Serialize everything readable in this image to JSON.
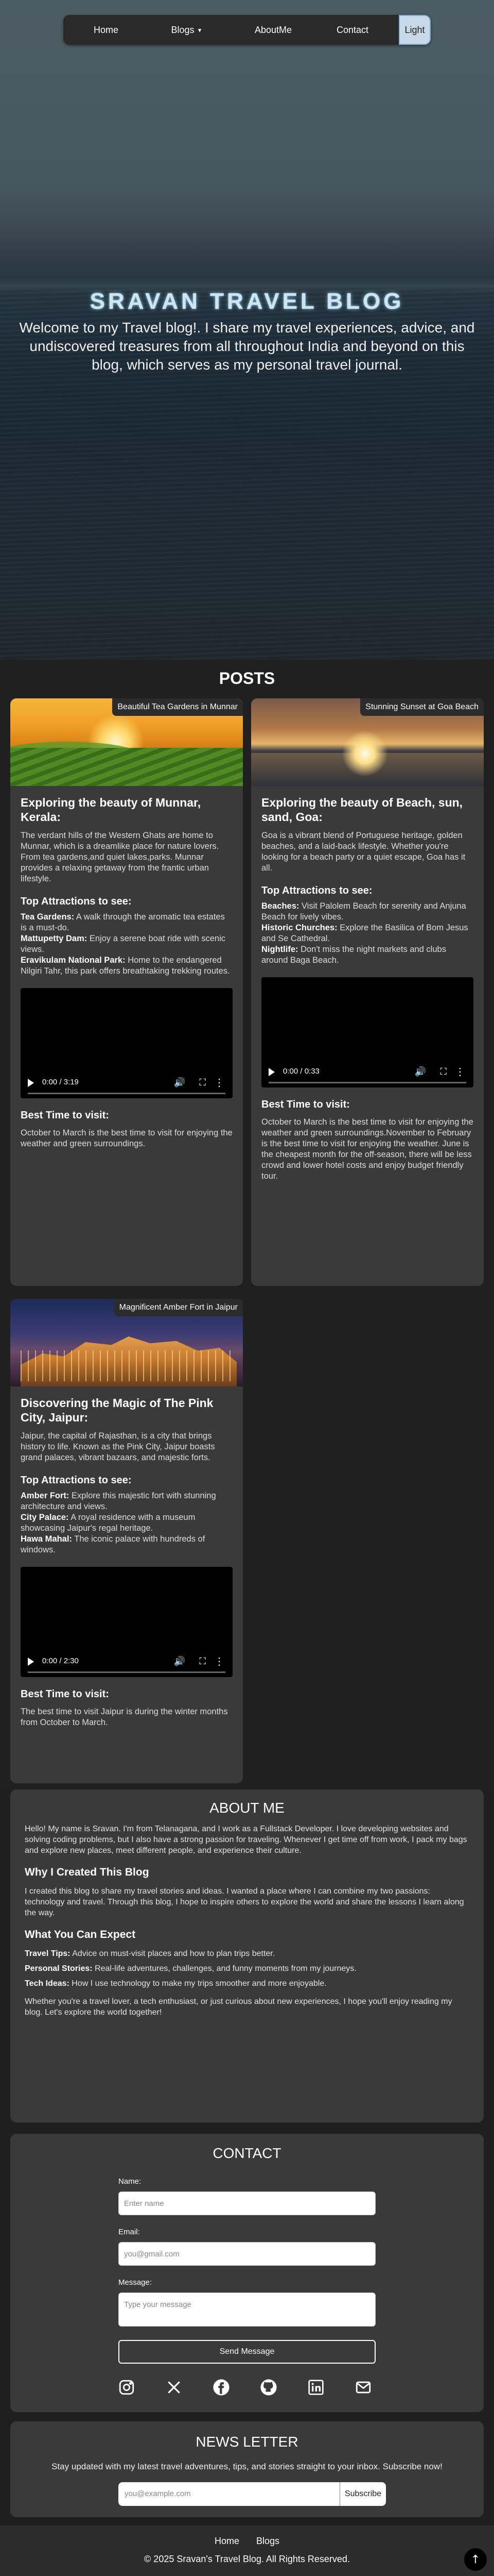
{
  "nav": {
    "home": "Home",
    "blogs": "Blogs",
    "about": "AboutMe",
    "contact": "Contact",
    "theme_toggle": "Light"
  },
  "hero": {
    "title": "SRAVAN TRAVEL BLOG",
    "subtitle": "Welcome to my Travel blog!. I share my travel experiences, advice, and undiscovered treasures from all throughout India and beyond on this blog, which serves as my personal travel journal."
  },
  "posts": {
    "title": "POSTS",
    "items": [
      {
        "caption": "Beautiful Tea Gardens in Munnar",
        "heading": "Exploring the beauty of Munnar, Kerala:",
        "intro": "The verdant hills of the Western Ghats are home to Munnar, which is a dreamlike place for nature lovers. From tea gardens,and quiet lakes,parks. Munnar provides a relaxing getaway from the frantic urban lifestyle.",
        "attractions_title": "Top Attractions to see:",
        "attractions": [
          {
            "name": "Tea Gardens:",
            "desc": "A walk through the aromatic tea estates is a must-do."
          },
          {
            "name": "Mattupetty Dam:",
            "desc": "Enjoy a serene boat ride with scenic views."
          },
          {
            "name": "Eravikulam National Park:",
            "desc": "Home to the endangered Nilgiri Tahr, this park offers breathtaking trekking routes."
          }
        ],
        "video_time": "0:00 / 3:19",
        "best_title": "Best Time to visit:",
        "best_text": "October to March is the best time to visit for enjoying the weather and green surroundings."
      },
      {
        "caption": "Stunning Sunset at Goa Beach",
        "heading": "Exploring the beauty of Beach, sun, sand, Goa:",
        "intro": "Goa is a vibrant blend of Portuguese heritage, golden beaches, and a laid-back lifestyle. Whether you're looking for a beach party or a quiet escape, Goa has it all.",
        "attractions_title": "Top Attractions to see:",
        "attractions": [
          {
            "name": "Beaches:",
            "desc": "Visit Palolem Beach for serenity and Anjuna Beach for lively vibes."
          },
          {
            "name": "Historic Churches:",
            "desc": "Explore the Basilica of Bom Jesus and Se Cathedral."
          },
          {
            "name": "Nightlife:",
            "desc": "Don't miss the night markets and clubs around Baga Beach."
          }
        ],
        "video_time": "0:00 / 0:33",
        "best_title": "Best Time to visit:",
        "best_text": "October to March is the best time to visit for enjoying the weather and green surroundings.November to February is the best time to visit for enjoying the weather. June is the cheapest month for the off-season, there will be less crowd and lower hotel costs and enjoy budget friendly tour."
      },
      {
        "caption": "Magnificent Amber Fort in Jaipur",
        "heading": "Discovering the Magic of The Pink City, Jaipur:",
        "intro": "Jaipur, the capital of Rajasthan, is a city that brings history to life. Known as the Pink City, Jaipur boasts grand palaces, vibrant bazaars, and majestic forts.",
        "attractions_title": "Top Attractions to see:",
        "attractions": [
          {
            "name": "Amber Fort:",
            "desc": "Explore this majestic fort with stunning architecture and views."
          },
          {
            "name": "City Palace:",
            "desc": "A royal residence with a museum showcasing Jaipur's regal heritage."
          },
          {
            "name": "Hawa Mahal:",
            "desc": "The iconic palace with hundreds of windows."
          }
        ],
        "video_time": "0:00 / 2:30",
        "best_title": "Best Time to visit:",
        "best_text": "The best time to visit Jaipur is during the winter months from October to March."
      }
    ]
  },
  "about": {
    "title": "ABOUT ME",
    "intro": "Hello! My name is Sravan. I'm from Telanagana, and I work as a Fullstack Developer. I love developing websites and solving coding problems, but I also have a strong passion for traveling. Whenever I get time off from work, I pack my bags and explore new places, meet different people, and experience their culture.",
    "why_title": "Why I Created This Blog",
    "why_text": "I created this blog to share my travel stories and ideas. I wanted a place where I can combine my two passions: technology and travel. Through this blog, I hope to inspire others to explore the world and share the lessons I learn along the way.",
    "expect_title": "What You Can Expect",
    "expect": [
      {
        "name": "Travel Tips:",
        "desc": "Advice on must-visit places and how to plan trips better."
      },
      {
        "name": "Personal Stories:",
        "desc": "Real-life adventures, challenges, and funny moments from my journeys."
      },
      {
        "name": "Tech Ideas:",
        "desc": "How I use technology to make my trips smoother and more enjoyable."
      }
    ],
    "outro": "Whether you're a travel lover, a tech enthusiast, or just curious about new experiences, I hope you'll enjoy reading my blog. Let's explore the world together!"
  },
  "contact": {
    "title": "CONTACT",
    "name_label": "Name:",
    "name_placeholder": "Enter name",
    "email_label": "Email:",
    "email_placeholder": "you@gmail.com",
    "message_label": "Message:",
    "message_placeholder": "Type your message",
    "send": "Send Message",
    "socials": [
      "instagram-icon",
      "x-icon",
      "facebook-icon",
      "github-icon",
      "linkedin-icon",
      "email-icon"
    ]
  },
  "newsletter": {
    "title": "NEWS LETTER",
    "text": "Stay updated with my latest travel adventures, tips, and stories straight to your inbox. Subscribe now!",
    "placeholder": "you@example.com",
    "button": "Subscribe"
  },
  "footer": {
    "home": "Home",
    "blogs": "Blogs",
    "copyright": "© 2025 Sravan's Travel Blog. All Rights Reserved."
  }
}
